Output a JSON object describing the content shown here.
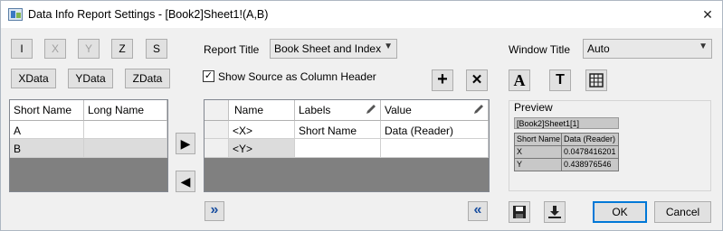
{
  "window": {
    "title": "Data Info Report Settings - [Book2]Sheet1!(A,B)",
    "close_glyph": "✕"
  },
  "left_toolbar": {
    "row1": [
      "I",
      "X",
      "Y",
      "Z",
      "S"
    ],
    "row1_disabled": [
      false,
      true,
      true,
      false,
      false
    ],
    "row2": [
      "XData",
      "YData",
      "ZData"
    ]
  },
  "source_grid": {
    "columns": [
      "Short Name",
      "Long Name"
    ],
    "rows": [
      [
        "A",
        ""
      ],
      [
        "B",
        ""
      ]
    ]
  },
  "move_buttons": {
    "right_glyph": "▶",
    "left_glyph": "◀",
    "expand_glyph": "»",
    "collapse_glyph": "«"
  },
  "report": {
    "title_label": "Report Title",
    "title_value": "Book Sheet and Index",
    "show_source_label": "Show Source as Column Header",
    "show_source_checked": true,
    "add_glyph": "+",
    "delete_glyph": "✕"
  },
  "report_grid": {
    "columns": [
      "Name",
      "Labels",
      "Value"
    ],
    "rows": [
      [
        "<X>",
        "Short Name",
        "Data (Reader)"
      ],
      [
        "<Y>",
        "",
        ""
      ]
    ]
  },
  "window_title": {
    "label": "Window Title",
    "value": "Auto"
  },
  "format_buttons": {
    "font_glyph": "A",
    "text_glyph": "T"
  },
  "preview": {
    "label": "Preview",
    "sheet_title": "[Book2]Sheet1[1]",
    "columns": [
      "Short Name",
      "Data (Reader)"
    ],
    "rows": [
      [
        "X",
        "0.0478416201"
      ],
      [
        "Y",
        "0.438976546"
      ]
    ]
  },
  "bottom": {
    "ok": "OK",
    "cancel": "Cancel"
  }
}
